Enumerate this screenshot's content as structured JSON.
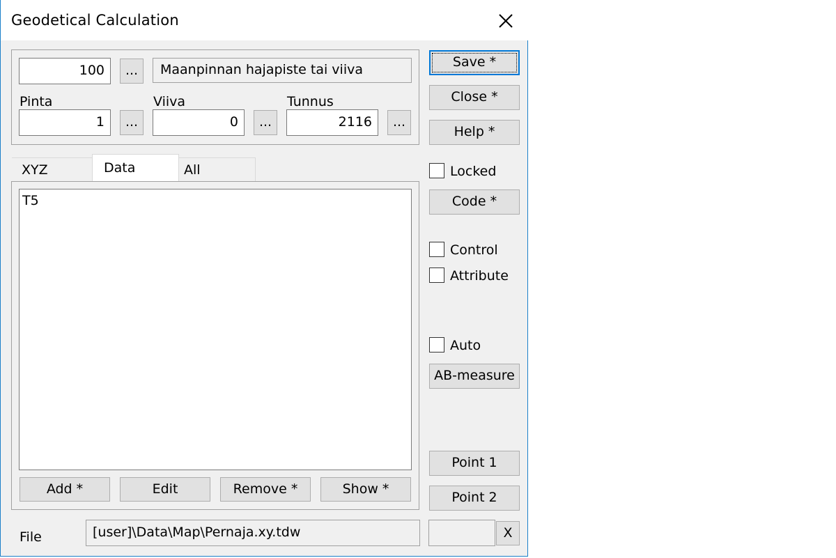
{
  "window": {
    "title": "Geodetical Calculation"
  },
  "header": {
    "code_value": "100",
    "description": "Maanpinnan hajapiste tai viiva",
    "browse_label": "...",
    "fields": [
      {
        "label": "Pinta",
        "value": "1"
      },
      {
        "label": "Viiva",
        "value": "0"
      },
      {
        "label": "Tunnus",
        "value": "2116"
      }
    ]
  },
  "tabs": [
    "XYZ",
    "Data",
    "All"
  ],
  "active_tab": "Data",
  "data_list": {
    "items": [
      "T5"
    ]
  },
  "list_buttons": {
    "add": "Add *",
    "edit": "Edit",
    "remove": "Remove *",
    "show": "Show *"
  },
  "side": {
    "save": "Save *",
    "close": "Close *",
    "help": "Help *",
    "locked": "Locked",
    "code": "Code *",
    "control": "Control",
    "attribute": "Attribute",
    "auto": "Auto",
    "ab_measure": "AB-measure",
    "point1": "Point 1",
    "point2": "Point 2",
    "clear": "X"
  },
  "file": {
    "label": "File",
    "path": "[user]\\Data\\Map\\Pernaja.xy.tdw",
    "extra": ""
  },
  "colors": {
    "accent": "#0078d7",
    "window_border": "#1a7fc9",
    "face": "#f0f0f0"
  }
}
